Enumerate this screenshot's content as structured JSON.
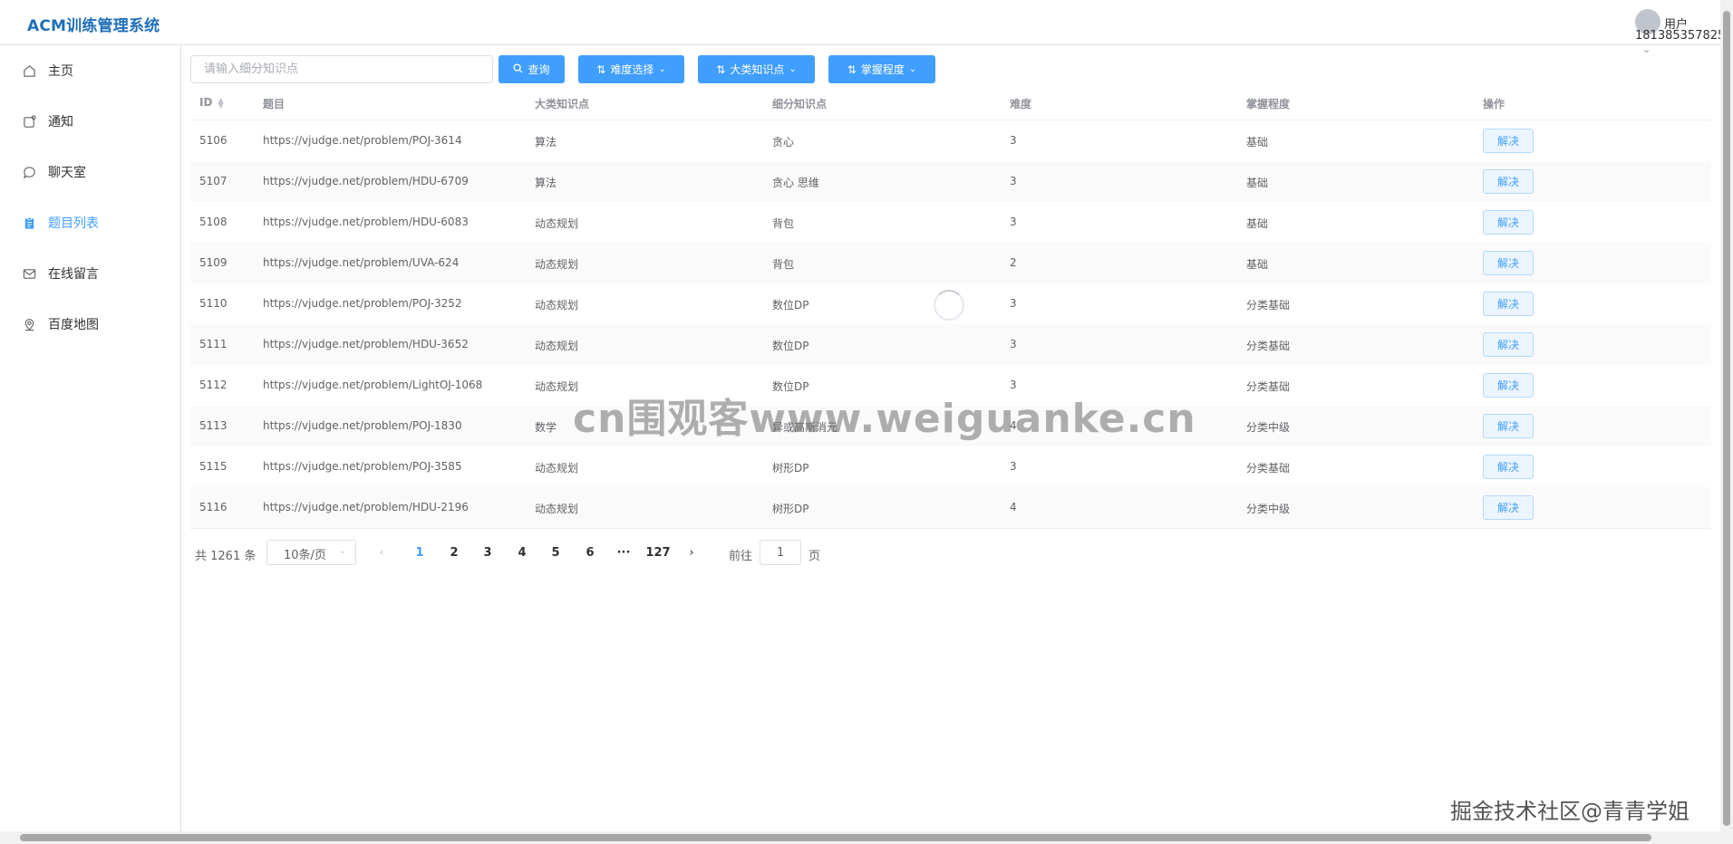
{
  "header": {
    "brand": "ACM训练管理系统",
    "user_name": "用户",
    "user_phone": "181385357825"
  },
  "sidebar": {
    "items": [
      {
        "label": "主页",
        "icon": "home-icon"
      },
      {
        "label": "通知",
        "icon": "notification-icon"
      },
      {
        "label": "聊天室",
        "icon": "chat-icon"
      },
      {
        "label": "题目列表",
        "icon": "clipboard-icon",
        "active": true
      },
      {
        "label": "在线留言",
        "icon": "mail-icon"
      },
      {
        "label": "百度地图",
        "icon": "map-pin-icon"
      }
    ]
  },
  "toolbar": {
    "search_placeholder": "请输入细分知识点",
    "search_button": "查询",
    "difficulty_button": "难度选择",
    "category_button": "大类知识点",
    "mastery_button": "掌握程度"
  },
  "table": {
    "headers": {
      "id": "ID",
      "problem": "题目",
      "category": "大类知识点",
      "subtopic": "细分知识点",
      "difficulty": "难度",
      "mastery": "掌握程度",
      "action": "操作"
    },
    "rows": [
      {
        "id": "5106",
        "problem": "https://vjudge.net/problem/POJ-3614",
        "category": "算法",
        "subtopic": "贪心",
        "difficulty": "3",
        "mastery": "基础",
        "action": "解决"
      },
      {
        "id": "5107",
        "problem": "https://vjudge.net/problem/HDU-6709",
        "category": "算法",
        "subtopic": "贪心 思维",
        "difficulty": "3",
        "mastery": "基础",
        "action": "解决"
      },
      {
        "id": "5108",
        "problem": "https://vjudge.net/problem/HDU-6083",
        "category": "动态规划",
        "subtopic": "背包",
        "difficulty": "3",
        "mastery": "基础",
        "action": "解决"
      },
      {
        "id": "5109",
        "problem": "https://vjudge.net/problem/UVA-624",
        "category": "动态规划",
        "subtopic": "背包",
        "difficulty": "2",
        "mastery": "基础",
        "action": "解决"
      },
      {
        "id": "5110",
        "problem": "https://vjudge.net/problem/POJ-3252",
        "category": "动态规划",
        "subtopic": "数位DP",
        "difficulty": "3",
        "mastery": "分类基础",
        "action": "解决"
      },
      {
        "id": "5111",
        "problem": "https://vjudge.net/problem/HDU-3652",
        "category": "动态规划",
        "subtopic": "数位DP",
        "difficulty": "3",
        "mastery": "分类基础",
        "action": "解决"
      },
      {
        "id": "5112",
        "problem": "https://vjudge.net/problem/LightOJ-1068",
        "category": "动态规划",
        "subtopic": "数位DP",
        "difficulty": "3",
        "mastery": "分类基础",
        "action": "解决"
      },
      {
        "id": "5113",
        "problem": "https://vjudge.net/problem/POJ-1830",
        "category": "数学",
        "subtopic": "异或高斯消元",
        "difficulty": "4",
        "mastery": "分类中级",
        "action": "解决"
      },
      {
        "id": "5115",
        "problem": "https://vjudge.net/problem/POJ-3585",
        "category": "动态规划",
        "subtopic": "树形DP",
        "difficulty": "3",
        "mastery": "分类基础",
        "action": "解决"
      },
      {
        "id": "5116",
        "problem": "https://vjudge.net/problem/HDU-2196",
        "category": "动态规划",
        "subtopic": "树形DP",
        "difficulty": "4",
        "mastery": "分类中级",
        "action": "解决"
      }
    ]
  },
  "pagination": {
    "total": "共 1261 条",
    "page_size": "10条/页",
    "pages": [
      "1",
      "2",
      "3",
      "4",
      "5",
      "6",
      "···",
      "127"
    ],
    "current": "1",
    "jump_label": "前往",
    "jump_value": "1",
    "jump_suffix": "页"
  },
  "watermarks": {
    "center": "cn围观客www.weiguanke.cn",
    "corner": "掘金技术社区@青青学姐"
  },
  "colors": {
    "primary": "#409eff",
    "brand": "#1f6fb8"
  }
}
